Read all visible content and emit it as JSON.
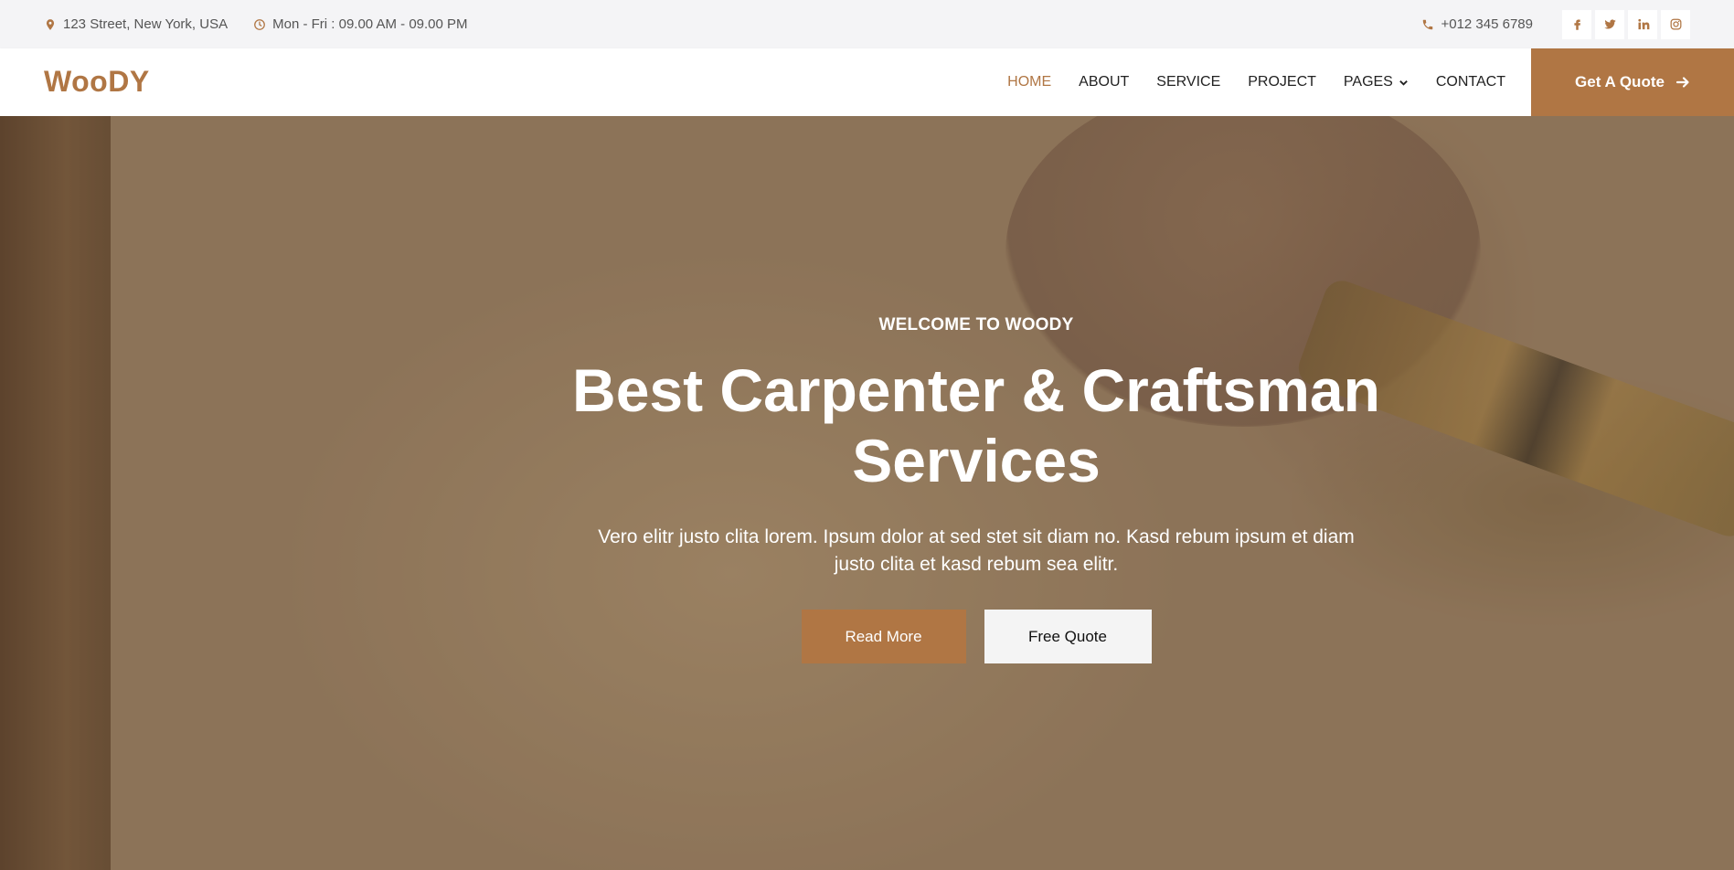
{
  "topbar": {
    "address": "123 Street, New York, USA",
    "hours": "Mon - Fri : 09.00 AM - 09.00 PM",
    "phone": "+012 345 6789",
    "socials": [
      "facebook-icon",
      "twitter-icon",
      "linkedin-icon",
      "instagram-icon"
    ]
  },
  "navbar": {
    "brand": "WooDY",
    "links": [
      "HOME",
      "ABOUT",
      "SERVICE",
      "PROJECT",
      "PAGES",
      "CONTACT"
    ],
    "active": "HOME",
    "cta": "Get A Quote"
  },
  "hero": {
    "kicker": "WELCOME TO WOODY",
    "title_line1": "Best Carpenter & Craftsman",
    "title_line2": "Services",
    "description": "Vero elitr justo clita lorem. Ipsum dolor at sed stet sit diam no. Kasd rebum ipsum et diam justo clita et kasd rebum sea elitr.",
    "primary_button": "Read More",
    "secondary_button": "Free Quote"
  },
  "colors": {
    "accent": "#b07644",
    "topbar_bg": "#f4f4f6",
    "text_dark": "#222222"
  }
}
